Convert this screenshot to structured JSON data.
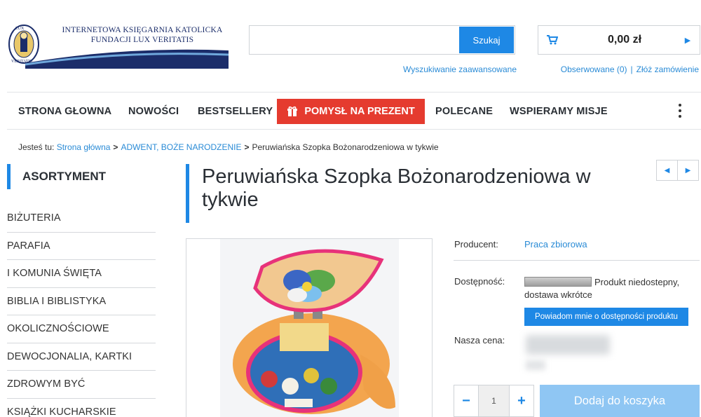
{
  "header": {
    "logo_line1": "INTERNETOWA KSIĘGARNIA KATOLICKA",
    "logo_line2": "FUNDACJI LUX VERITATIS",
    "search": {
      "button": "Szukaj",
      "placeholder": "",
      "advanced_link": "Wyszukiwanie zaawansowane"
    },
    "cart": {
      "amount": "0,00 zł",
      "icon": "cart-icon"
    },
    "links": {
      "watched": "Obserwowane (0)",
      "separator": "|",
      "order": "Złóż zamówienie"
    }
  },
  "nav": {
    "items": [
      "STRONA GŁOWNA",
      "NOWOŚCI",
      "BESTSELLERY",
      "POLECANE",
      "WSPIERAMY MISJE"
    ],
    "gift": "POMYSŁ NA PREZENT",
    "gift_color": "#e53b2f"
  },
  "breadcrumb": {
    "prefix": "Jesteś tu:",
    "home": "Strona główna",
    "category": "ADWENT, BOŻE NARODZENIE",
    "current": "Peruwiańska Szopka Bożonarodzeniowa w tykwie",
    "sep": ">"
  },
  "sidebar": {
    "title": "ASORTYMENT",
    "items": [
      "BIŻUTERIA",
      "PARAFIA",
      "I KOMUNIA ŚWIĘTA",
      "BIBLIA I BIBLISTYKA",
      "OKOLICZNOŚCIOWE",
      "DEWOCJONALIA, KARTKI",
      "ZDROWYM BYĆ",
      "KSIĄŻKI KUCHARSKIE"
    ]
  },
  "product": {
    "title": "Peruwiańska Szopka Bożonarodzeniowa w tykwie",
    "producer_label": "Producent:",
    "producer": "Praca zbiorowa",
    "availability_label": "Dostępność:",
    "availability": "Produkt niedostepny,",
    "availability_note": "dostawa wkrótce",
    "notify_button": "Powiadom mnie o dostępności produktu",
    "price_label": "Nasza cena:",
    "quantity": "1",
    "qty_minus": "−",
    "qty_plus": "+",
    "add_to_cart": "Dodaj do koszyka"
  },
  "colors": {
    "accent": "#1e88e5",
    "link": "#2a8bd6",
    "add_to_cart_disabled": "#8fc6f3"
  }
}
